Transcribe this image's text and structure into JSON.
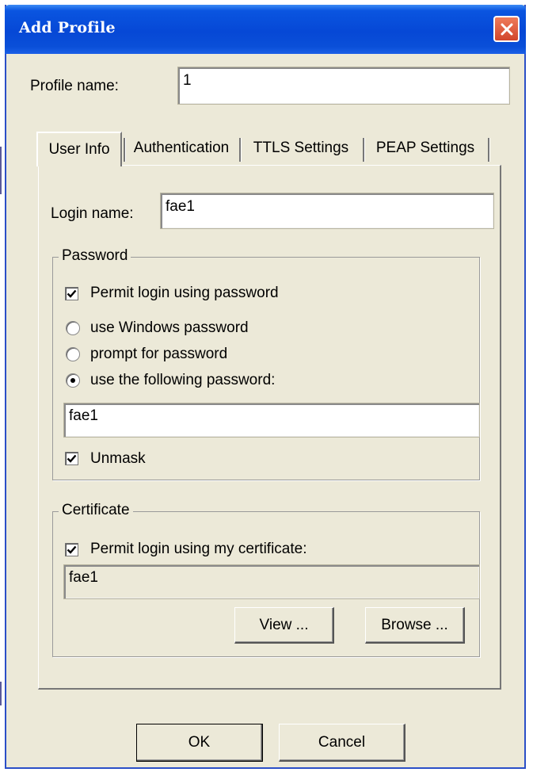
{
  "window": {
    "title": "Add Profile"
  },
  "profile": {
    "label": "Profile name:",
    "value": "1"
  },
  "tabs": [
    {
      "label": "User Info"
    },
    {
      "label": "Authentication"
    },
    {
      "label": "TTLS Settings"
    },
    {
      "label": "PEAP Settings"
    }
  ],
  "login": {
    "label": "Login name:",
    "value": "fae1"
  },
  "password": {
    "group_label": "Password",
    "permit_label": "Permit login using password",
    "permit_checked": true,
    "options": [
      {
        "label": "use Windows password",
        "selected": false
      },
      {
        "label": "prompt for password",
        "selected": false
      },
      {
        "label": "use the following password:",
        "selected": true
      }
    ],
    "value": "fae1",
    "unmask_label": "Unmask",
    "unmask_checked": true
  },
  "certificate": {
    "group_label": "Certificate",
    "permit_label": "Permit login using my certificate:",
    "permit_checked": true,
    "value": "fae1",
    "view_label": "View ...",
    "browse_label": "Browse ..."
  },
  "buttons": {
    "ok": "OK",
    "cancel": "Cancel"
  },
  "icons": {
    "close": "close-icon",
    "checkmark": "checkmark-icon"
  },
  "colors": {
    "titlebar": "#0648d6",
    "face": "#ece9d8",
    "close": "#d2452b"
  }
}
